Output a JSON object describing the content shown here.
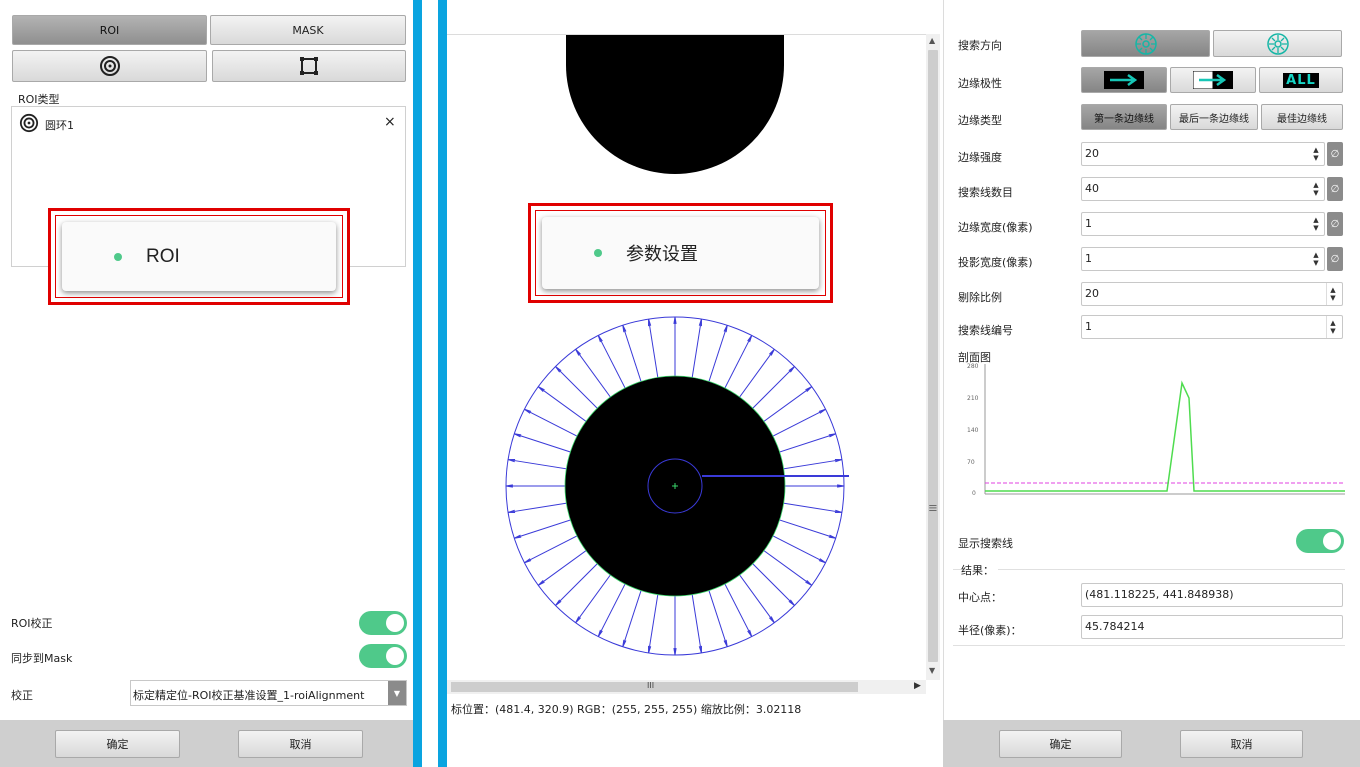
{
  "left": {
    "tabs": {
      "roi": "ROI",
      "mask": "MASK"
    },
    "roi_type_label": "ROI类型",
    "roi_list": [
      {
        "name": "圆环1",
        "icon": "ring-icon",
        "close": "×"
      }
    ],
    "callout": "ROI",
    "roi_correct_label": "ROI校正",
    "sync_mask_label": "同步到Mask",
    "correct_label": "校正",
    "correct_value": "标定精定位-ROI校正基准设置_1-roiAlignment",
    "ok": "确定",
    "cancel": "取消"
  },
  "center": {
    "callout": "参数设置",
    "status": "标位置：(481.4, 320.9) RGB：(255, 255, 255) 缩放比例：3.02118",
    "scroll_grip": "III",
    "scroll_grip_v": "|||"
  },
  "right": {
    "search_direction_label": "搜索方向",
    "edge_polarity_label": "边缘极性",
    "polarity_all": "ALL",
    "edge_type_label": "边缘类型",
    "edge_types": [
      "第一条边缘线",
      "最后一条边缘线",
      "最佳边缘线"
    ],
    "edge_strength_label": "边缘强度",
    "edge_strength": "20",
    "search_lines_label": "搜索线数目",
    "search_lines": "40",
    "edge_width_label": "边缘宽度(像素)",
    "edge_width": "1",
    "proj_width_label": "投影宽度(像素)",
    "proj_width": "1",
    "remove_ratio_label": "剔除比例",
    "remove_ratio": "20",
    "line_index_label": "搜索线编号",
    "line_index": "1",
    "profile_label": "剖面图",
    "chart_yticks": [
      "280",
      "210",
      "140",
      "70",
      "0"
    ],
    "show_lines_label": "显示搜索线",
    "result_label": "结果：",
    "center_label": "中心点：",
    "center_value": "(481.118225, 441.848938)",
    "radius_label": "半径(像素)：",
    "radius_value": "45.784214",
    "ok": "确定",
    "cancel": "取消"
  },
  "colors": {
    "accent_green": "#4fc98a",
    "callout_red": "#e00000",
    "divider_blue": "#0aa4e0",
    "search_line_blue": "#3a3ad8"
  }
}
